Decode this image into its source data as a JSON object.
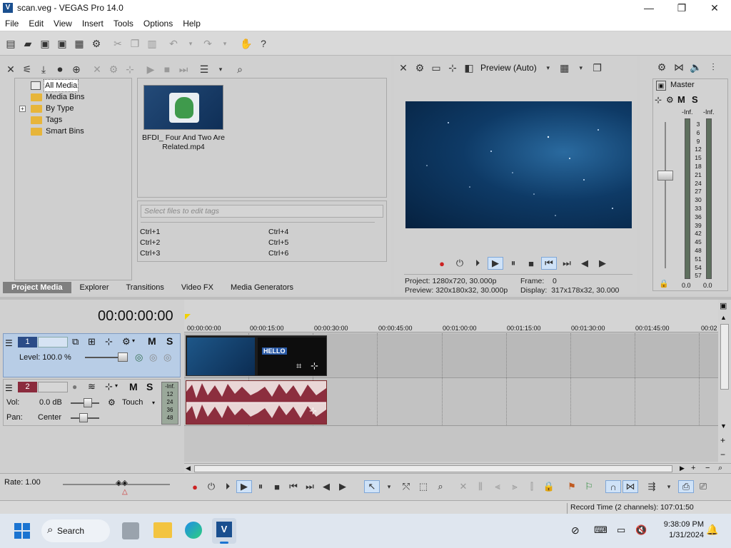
{
  "window": {
    "title": "scan.veg - VEGAS Pro 14.0",
    "controls": {
      "minimize": "—",
      "maximize": "❐",
      "close": "✕"
    }
  },
  "menu": [
    "File",
    "Edit",
    "View",
    "Insert",
    "Tools",
    "Options",
    "Help"
  ],
  "media_tree": {
    "items": [
      {
        "label": "All Media",
        "selected": true
      },
      {
        "label": "Media Bins"
      },
      {
        "label": "By Type",
        "expand": "+"
      },
      {
        "label": "Tags"
      },
      {
        "label": "Smart Bins"
      }
    ]
  },
  "media_file": {
    "name": "BFDI_ Four And Two Are Related.mp4"
  },
  "tags": {
    "placeholder": "Select files to edit tags",
    "shortcuts": [
      "Ctrl+1",
      "Ctrl+4",
      "Ctrl+2",
      "Ctrl+5",
      "Ctrl+3",
      "Ctrl+6"
    ]
  },
  "left_tabs": [
    "Project Media",
    "Explorer",
    "Transitions",
    "Video FX",
    "Media Generators"
  ],
  "preview": {
    "mode": "Preview (Auto)",
    "project_label": "Project:",
    "project_value": "1280x720, 30.000p",
    "preview_label": "Preview:",
    "preview_value": "320x180x32, 30.000p",
    "frame_label": "Frame:",
    "frame_value": "0",
    "display_label": "Display:",
    "display_value": "317x178x32, 30.000"
  },
  "master": {
    "label": "Master",
    "mute": "M",
    "solo": "S",
    "inf_left": "-Inf.",
    "inf_right": "-Inf.",
    "scale": [
      "3",
      "6",
      "9",
      "12",
      "15",
      "18",
      "21",
      "24",
      "27",
      "30",
      "33",
      "36",
      "39",
      "42",
      "45",
      "48",
      "51",
      "54",
      "57"
    ],
    "bottom_left": "0.0",
    "bottom_right": "0.0"
  },
  "timeline": {
    "timecode": "00:00:00:00",
    "ruler": [
      "00:00:00:00",
      "00:00:15:00",
      "00:00:30:00",
      "00:00:45:00",
      "00:01:00:00",
      "00:01:15:00",
      "00:01:30:00",
      "00:01:45:00",
      "00:02"
    ],
    "rate": "Rate: 1.00"
  },
  "video_track": {
    "number": "1",
    "level": "Level: 100.0 %",
    "mute": "M",
    "solo": "S",
    "clip_text": "HELLO"
  },
  "audio_track": {
    "number": "2",
    "vol_label": "Vol:",
    "vol_value": "0.0 dB",
    "pan_label": "Pan:",
    "pan_value": "Center",
    "mode": "Touch",
    "mute": "M",
    "solo": "S",
    "meter": [
      "-Inf.",
      "12",
      "24",
      "36",
      "48"
    ]
  },
  "status": {
    "record_time": "Record Time (2 channels): 107:01:50"
  },
  "taskbar": {
    "search": "Search",
    "time": "9:38:09 PM",
    "date": "1/31/2024"
  }
}
